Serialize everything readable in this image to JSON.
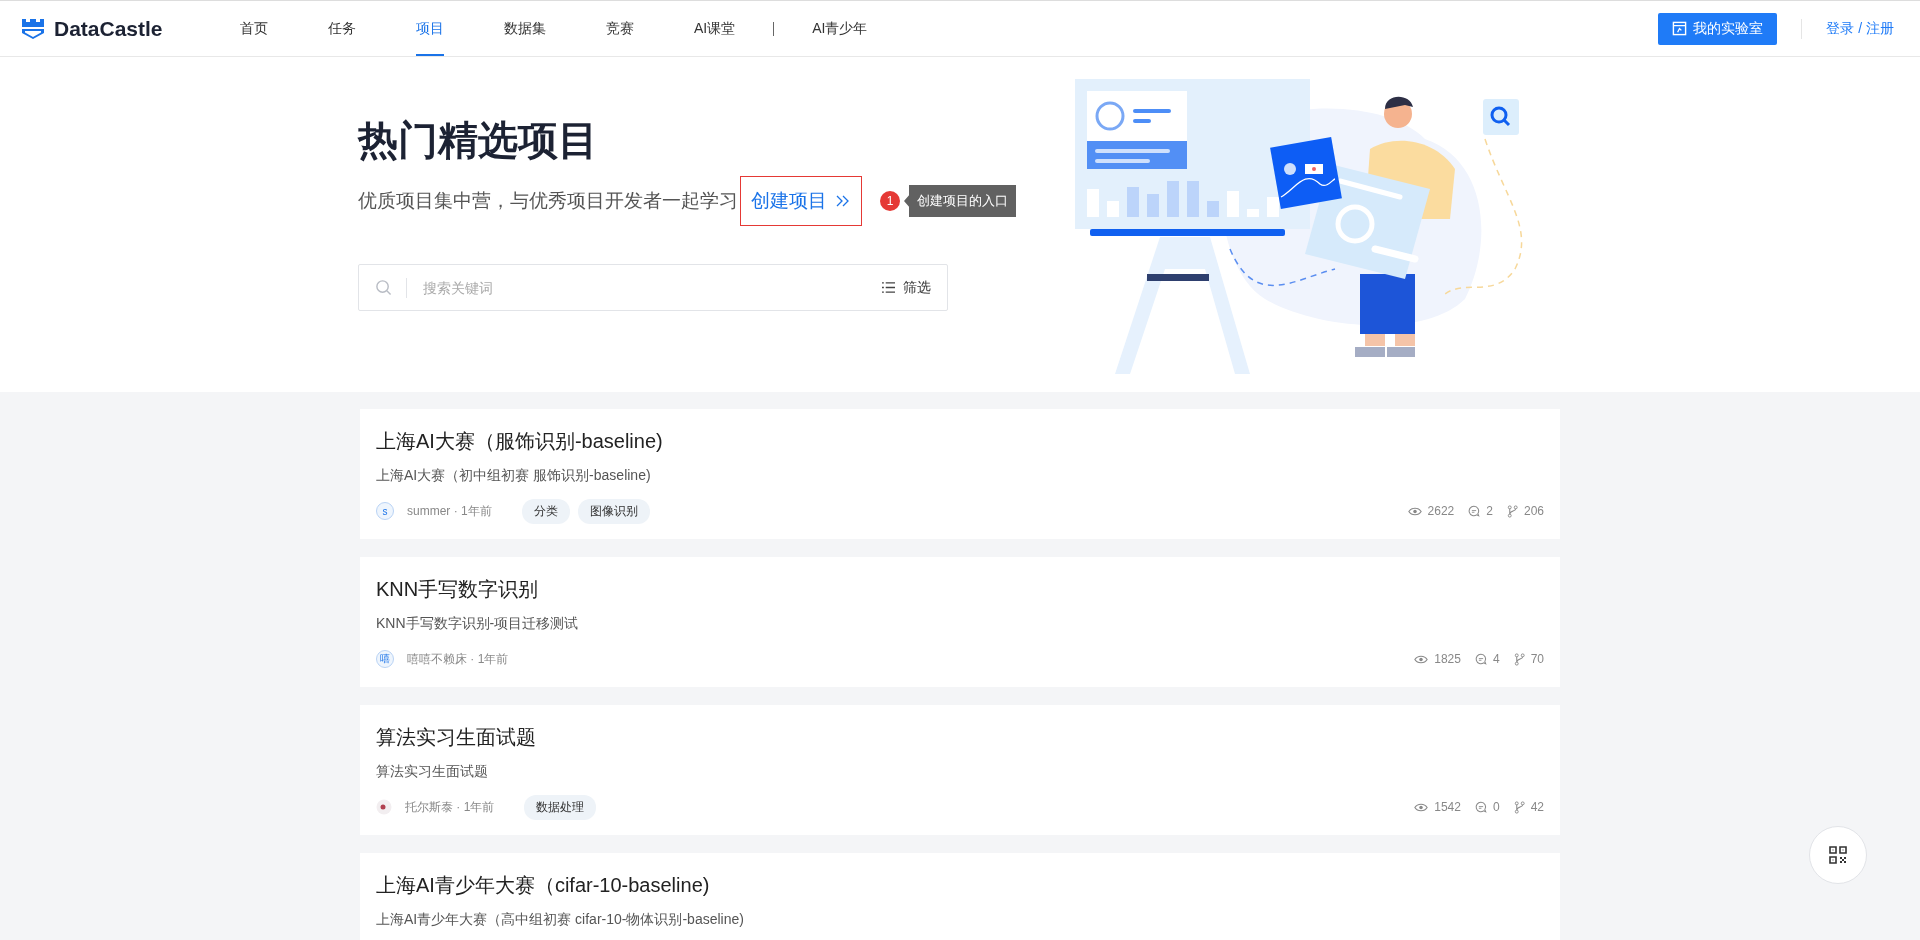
{
  "header": {
    "logo": "DataCastle",
    "nav": [
      {
        "label": "首页",
        "selected": false
      },
      {
        "label": "任务",
        "selected": false
      },
      {
        "label": "项目",
        "selected": true
      },
      {
        "label": "数据集",
        "selected": false
      },
      {
        "label": "竞赛",
        "selected": false
      },
      {
        "label": "AI课堂",
        "selected": false
      },
      {
        "label": "AI青少年",
        "selected": false
      }
    ],
    "lab_button": "我的实验室",
    "login": "登录 / 注册"
  },
  "hero": {
    "title": "热门精选项目",
    "subtitle": "优质项目集中营，与优秀项目开发者一起学习",
    "create_link": "创建项目",
    "annotation": {
      "number": "1",
      "text": "创建项目的入口"
    },
    "search": {
      "placeholder": "搜索关键词"
    },
    "filter": "筛选"
  },
  "projects": [
    {
      "title": "上海AI大赛（服饰识别-baseline)",
      "description": "上海AI大赛（初中组初赛 服饰识别-baseline)",
      "avatar": "s",
      "meta": "summer · 1年前",
      "tags": [
        "分类",
        "图像识别"
      ],
      "views": "2622",
      "comments": "2",
      "forks": "206"
    },
    {
      "title": "KNN手写数字识别",
      "description": "KNN手写数字识别-项目迁移测试",
      "avatar": "嘻",
      "meta": "嘻嘻不赖床 · 1年前",
      "views": "1825",
      "comments": "4",
      "forks": "70"
    },
    {
      "title": "算法实习生面试题",
      "description": "算法实习生面试题",
      "meta": "托尔斯泰 · 1年前",
      "tags": [
        "数据处理"
      ],
      "views": "1542",
      "comments": "0",
      "forks": "42"
    },
    {
      "title": "上海AI青少年大赛（cifar-10-baseline)",
      "description": "上海AI青少年大赛（高中组初赛 cifar-10-物体识别-baseline)"
    }
  ]
}
